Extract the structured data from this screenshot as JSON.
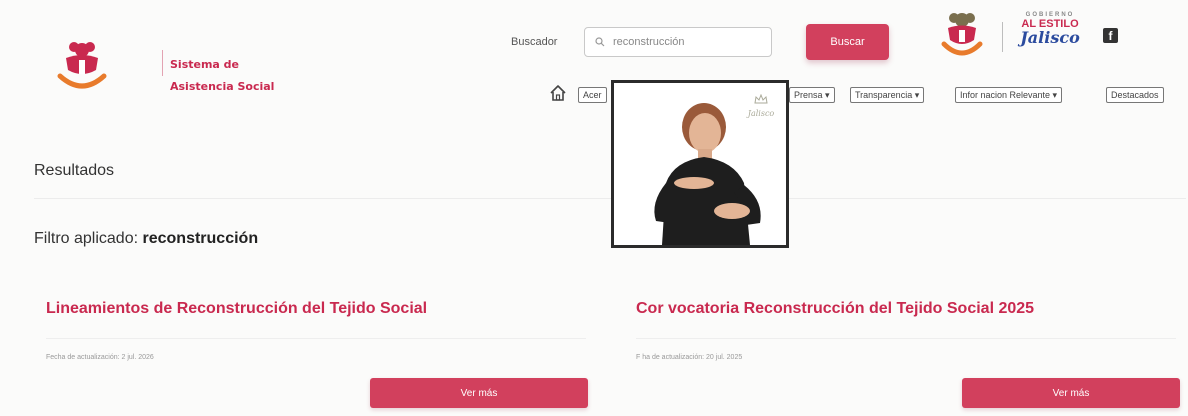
{
  "header": {
    "logo": {
      "line1": "Sistema de",
      "line2": "Asistencia Social"
    },
    "search": {
      "label": "Buscador",
      "value": "reconstrucción",
      "button_label": "Buscar"
    },
    "brand": {
      "top": "GOBIERNO",
      "middle": "AL ESTILO",
      "bottom": "Jalisco"
    },
    "social": {
      "facebook_glyph": "f"
    }
  },
  "nav": {
    "items": [
      {
        "label": "Acer"
      },
      {
        "label": "Prensa ▾"
      },
      {
        "label": "Transparencia ▾"
      },
      {
        "label": "Infor  nacion Relevante ▾"
      },
      {
        "label": "Destacados"
      }
    ]
  },
  "main": {
    "results_title": "Resultados",
    "filter_prefix": "Filtro aplicado: ",
    "filter_value": "reconstrucción",
    "cards": [
      {
        "title": "Lineamientos de Reconstrucción del Tejido Social",
        "date": "Fecha de actualización: 2 jul. 2026",
        "button_label": "Ver más"
      },
      {
        "title": "Cor vocatoria Reconstrucción del Tejido Social 2025",
        "date": "F    ha de actualización: 20 jul. 2025",
        "button_label": "Ver más"
      }
    ]
  },
  "video": {
    "logo_text": "Jalisco"
  },
  "colors": {
    "brand_pink": "#c9294f",
    "button_pink": "#d2405d",
    "brand_orange": "#e87b2c",
    "jalisco_blue": "#2b4b9e"
  }
}
